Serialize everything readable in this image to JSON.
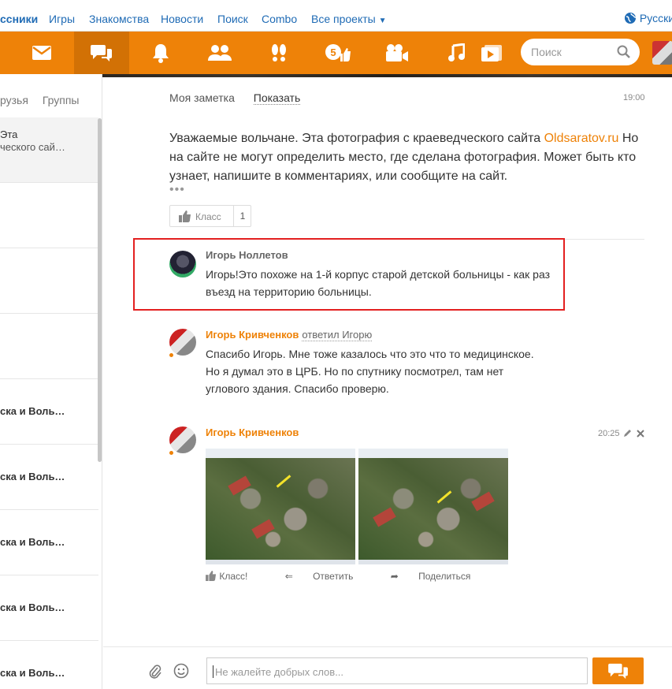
{
  "topnav": {
    "brand": "ссники",
    "links": [
      "Игры",
      "Знакомства",
      "Новости",
      "Поиск",
      "Combo",
      "Все проекты"
    ],
    "language": "Русски"
  },
  "toolbar": {
    "icons": [
      "mail-icon",
      "messages-icon",
      "bell-icon",
      "friends-icon",
      "guests-icon",
      "events-icon",
      "video-icon",
      "music-icon",
      "play-icon"
    ],
    "events_badge": "5",
    "search_placeholder": "Поиск"
  },
  "sidebar": {
    "tabs": [
      "рузья",
      "Группы"
    ],
    "items": [
      {
        "line1": "Эта",
        "line2": "ческого сай…"
      },
      {
        "line1": "ска и Воль…"
      },
      {
        "line1": "ска и Воль…"
      },
      {
        "line1": "ска и Воль…"
      },
      {
        "line1": "ска и Воль…"
      },
      {
        "line1": "ска и Воль…"
      }
    ]
  },
  "note": {
    "label": "Моя заметка",
    "show": "Показать",
    "time": "19:00",
    "text_before": "Уважаемые вольчане. Эта фотография с краеведческого сайта ",
    "link": "Oldsaratov.ru",
    "text_after": " Но на сайте не могут определить  место, где сделана фотография. Может быть кто узнает, напишите в комментариях, или сообщите на сайт.",
    "more": "•••",
    "klass_label": "Класс",
    "klass_count": "1"
  },
  "comments": [
    {
      "name": "Игорь Ноллетов",
      "text": "Игорь!Это похоже на 1-й корпус старой детской больницы - как раз въезд на территорию больницы."
    },
    {
      "name": "Игорь Кривченков",
      "reply_to": "ответил Игорю",
      "text": "Спасибо Игорь. Мне тоже казалось что это что то медицинское. Но я думал это в ЦРБ. Но по спутнику посмотрел, там нет углового здания. Спасибо проверю."
    },
    {
      "name": "Игорь Кривченков",
      "time": "20:25",
      "actions": [
        "Класс!",
        "Ответить",
        "Поделиться"
      ]
    }
  ],
  "composer": {
    "placeholder": "Не жалейте добрых слов..."
  },
  "colors": {
    "accent": "#ee8208",
    "link": "#1f6bb5",
    "highlight": "#e32020"
  }
}
